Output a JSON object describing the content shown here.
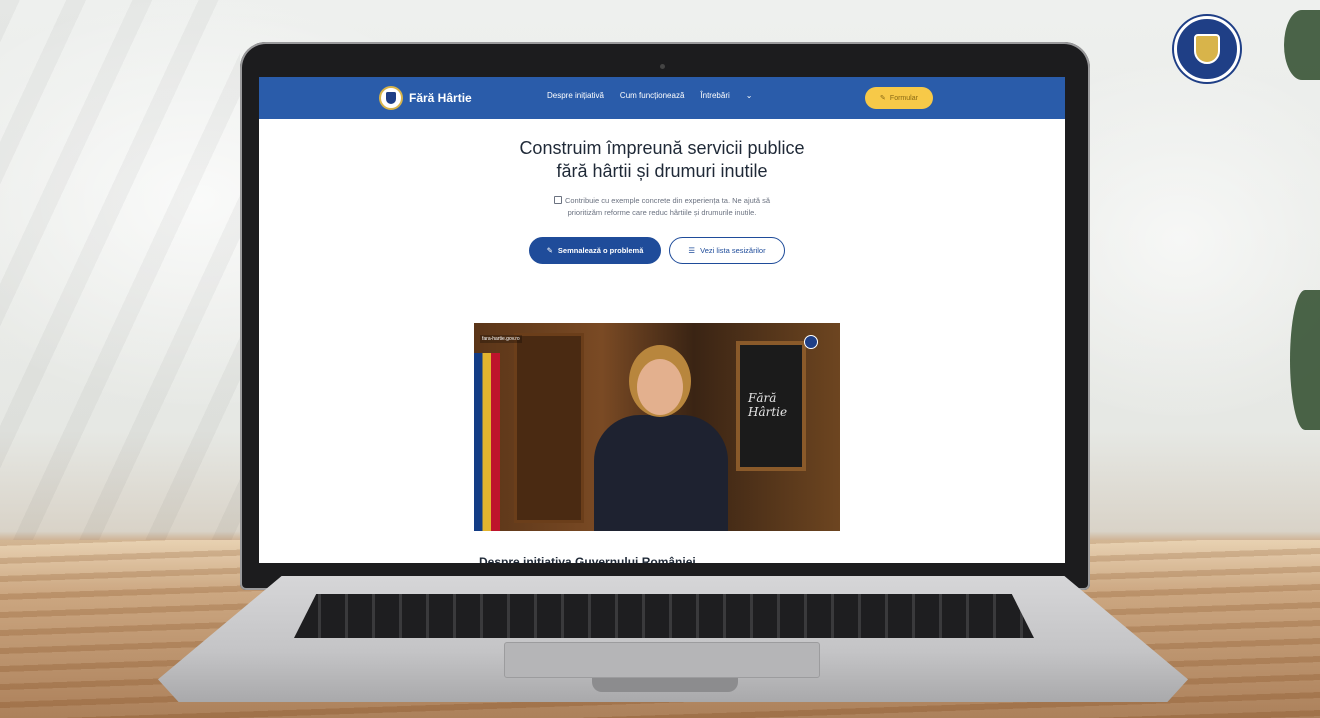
{
  "gov_logo": {
    "text": "GUVERNUL ROMÂNIEI"
  },
  "site": {
    "brand_name": "Fără Hârtie",
    "nav": [
      {
        "label": "Despre inițiativă"
      },
      {
        "label": "Cum funcționează"
      },
      {
        "label": "Întrebări"
      }
    ],
    "form_button": "Formular",
    "hero": {
      "title_line1": "Construim împreună servicii publice",
      "title_line2": "fără hârtii și drumuri inutile",
      "subtitle_line1": "Contribuie cu exemple concrete din experiența ta. Ne ajută să",
      "subtitle_line2": "prioritizăm reforme care reduc hârtiile și drumurile inutile.",
      "primary_button": "Semnalează o problemă",
      "secondary_button": "Vezi lista sesizărilor"
    },
    "video": {
      "url_overlay": "fara-hartie.gov.ro",
      "board_text": "Fără Hârtie"
    },
    "below_video_heading": "Despre inițiativa Guvernului României"
  },
  "colors": {
    "header_blue": "#2a5caa",
    "primary_blue": "#1f4c9a",
    "accent_yellow": "#f7c948"
  }
}
